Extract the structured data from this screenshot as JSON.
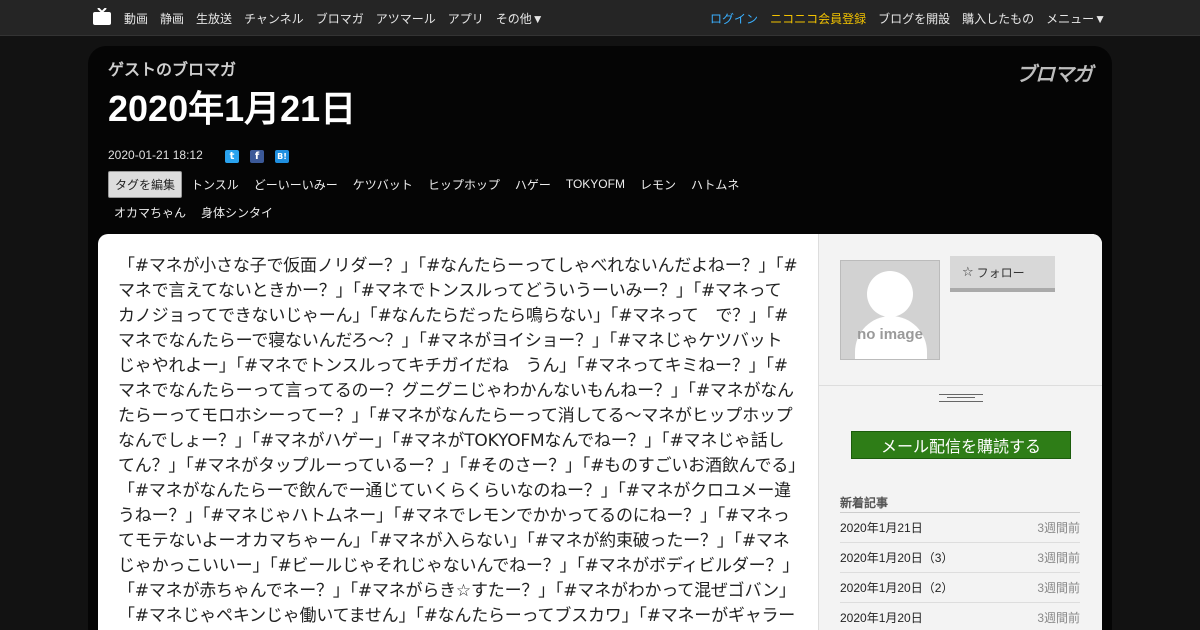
{
  "topnav": {
    "left": [
      "動画",
      "静画",
      "生放送",
      "チャンネル",
      "ブロマガ",
      "アツマール",
      "アプリ",
      "その他▼"
    ],
    "login": "ログイン",
    "register": "ニコニコ会員登録",
    "open_blog": "ブログを開設",
    "purchased": "購入したもの",
    "menu": "メニュー▼"
  },
  "blog": {
    "name": "ゲストのブロマガ",
    "brand": "ブロマガ",
    "title": "2020年1月21日",
    "date": "2020-01-21 18:12"
  },
  "share": {
    "twitter": "t",
    "facebook": "f",
    "hatena": "B!"
  },
  "tags": {
    "edit_label": "タグを編集",
    "row1": [
      "トンスル",
      "どーいーいみー",
      "ケツバット",
      "ヒップホップ",
      "ハゲー",
      "TOKYOFM",
      "レモン",
      "ハトムネ"
    ],
    "row2": [
      "オカマちゃん",
      "身体シンタイ"
    ]
  },
  "article": {
    "body": "「#マネが小さな子で仮面ノリダー？」「#なんたらーってしゃべれないんだよねー？」「#マネで言えてないときかー？」「#マネでトンスルってどういうーいみー？」「#マネってカノジョってできないじゃーん」「#なんたらだったら鳴らない」「#マネって　で？」「#マネでなんたらーで寝ないんだろ〜？」「#マネがヨイショー？」「#マネじゃケツバットじゃやれよー」「#マネでトンスルってキチガイだね　うん」「#マネってキミねー？」「#マネでなんたらーって言ってるのー？グニグニじゃわかんないもんねー？」「#マネがなんたらーってモロホシーってー？」「#マネがなんたらーって消してる〜マネがヒップホップなんでしょー？」「#マネがハゲー」「#マネがTOKYOFMなんでねー？」「#マネじゃ話してん？」「#マネがタップルーっているー？」「#そのさー？」「#ものすごいお酒飲んでる」「#マネがなんたらーで飲んでー通じていくらくらいなのねー？」「#マネがクロユメー違うねー？」「#マネじゃハトムネー」「#マネでレモンでかかってるのにねー？」「#マネってモテないよーオカマちゃーん」「#マネが入らない」「#マネが約束破ったー？」「#マネじゃかっこいいー」「#ビールじゃそれじゃないんでねー？」「#マネがボディビルダー？」「#マネが赤ちゃんでネー？」「#マネがらき☆すたー？」「#マネがわかって混ぜゴバン」「#マネじゃペキンじゃ働いてません」「#なんたらーってブスカワ」「#マネーがギャラーをやってないんだよねー？」「#マネ"
  },
  "sidebar": {
    "no_image": "no image",
    "follow": "フォロー",
    "subscribe": "メール配信を購読する",
    "recent_heading": "新着記事",
    "recent": [
      {
        "title": "2020年1月21日",
        "age": "3週間前"
      },
      {
        "title": "2020年1月20日（3）",
        "age": "3週間前"
      },
      {
        "title": "2020年1月20日（2）",
        "age": "3週間前"
      },
      {
        "title": "2020年1月20日",
        "age": "3週間前"
      }
    ]
  },
  "colors": {
    "page_bg": "#121212",
    "nav_bg": "#252525",
    "login": "#3ab0ff",
    "register": "#f2c200",
    "subscribe": "#2e7d17"
  }
}
